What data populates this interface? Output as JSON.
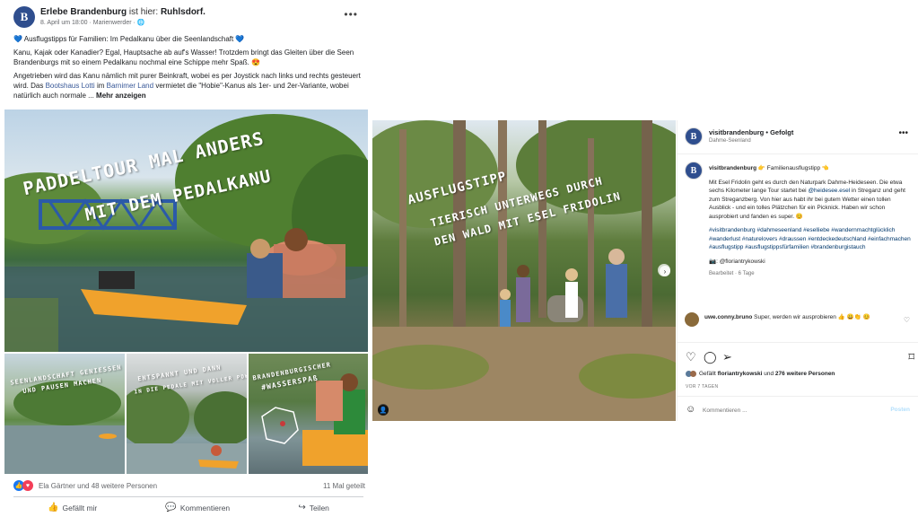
{
  "facebook": {
    "avatar_letter": "B",
    "page_name": "Erlebe Brandenburg",
    "is_here": "ist hier:",
    "location": "Ruhlsdorf.",
    "meta": "8. April um 18:00 · Marienwerder · ",
    "text": {
      "line1": "💙 Ausflugstipps für Familien: Im Pedalkanu über die Seenlandschaft 💙",
      "para2": "Kanu, Kajak oder Kanadier? Egal, Hauptsache ab auf's Wasser! Trotzdem bringt das Gleiten über die Seen Brandenburgs mit so einem Pedalkanu nochmal eine Schippe mehr Spaß. 😍",
      "para3_a": "Angetrieben wird das Kanu nämlich mit purer Beinkraft, wobei es per Joystick nach links und rechts gesteuert wird. Das ",
      "link1": "Bootshaus Lotti",
      "para3_b": " im ",
      "link2": "Barnimer Land",
      "para3_c": " vermietet die \"Hobie\"-Kanus als 1er- und 2er-Variante, wobei natürlich auch normale ...",
      "more": " Mehr anzeigen"
    },
    "main_overlay": {
      "line1": "PADDELTOUR MAL ANDERS",
      "line2": "MIT DEM PEDALKANU"
    },
    "thumb_overlays": {
      "t1a": "SEENLANDSCHAFT GENIESSEN",
      "t1b": "UND PAUSEN MACHEN",
      "t2a": "ENTSPANNT UND DANN",
      "t2b": "IN DIE PEDALE MIT VOLLER POWER",
      "t3a": "BRANDENBURGISCHER",
      "t3b": "#WASSERSPAß"
    },
    "reactions": {
      "likes": "Ela Gärtner und 48 weitere Personen",
      "shares": "11 Mal geteilt"
    },
    "actions": {
      "like": "Gefällt mir",
      "comment": "Kommentieren",
      "share": "Teilen"
    }
  },
  "instagram": {
    "photo_overlay": {
      "line1": "AUSFLUGSTIPP",
      "line2": "TIERISCH UNTERWEGS DURCH",
      "line3": "DEN WALD MIT ESEL FRIDOLIN"
    },
    "header": {
      "user": "visitbrandenburg",
      "separator": "•",
      "follow_status": "Gefolgt",
      "location": "Dahme-Seenland"
    },
    "caption": {
      "user": "visitbrandenburg",
      "title": "👉 Familienausflugstipp 👈",
      "body_a": "Mit Esel Fridolin geht es durch den Naturpark Dahme-Heideseen. Die etwa sechs Kilometer lange Tour startet bei ",
      "mention": "@heidesee.esel",
      "body_b": " in Streganz und geht zum Streganzberg. Von hier aus habt ihr bei gutem Wetter einen tollen Ausblick - und ein tolles Plätzchen für ein Picknick. Haben wir schon ausprobiert und fanden es super. 😊",
      "hashtags": "#visitbrandenburg #dahmeseenland #eselliebe #wandernmachtglücklich #wanderlust #naturelovers #draussen #entdeckedeutschland #einfachmachen #ausflugstipp #ausflugstippsfürfamilien #brandenburgistauch",
      "photo_credit": "📷: @floriantrykowski",
      "edited": "Bearbeitet · 6 Tage"
    },
    "comment": {
      "user": "uwe.conny.bruno",
      "text": "Super, werden wir ausprobieren 👍 😀👏 😊"
    },
    "likes": {
      "prefix": "Gefällt ",
      "user": "floriantrykowski",
      "middle": " und ",
      "count": "276 weitere Personen"
    },
    "date": "VOR 7 TAGEN",
    "input_placeholder": "Kommentieren ...",
    "post_button": "Posten"
  }
}
